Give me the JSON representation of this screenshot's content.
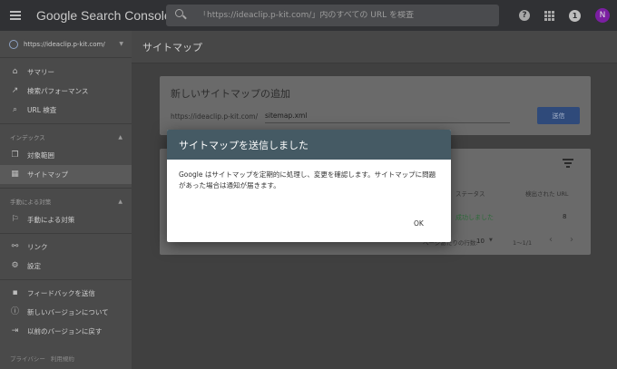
{
  "app": {
    "title": "Google Search Console"
  },
  "search": {
    "placeholder": "「https://ideaclip.p-kit.com/」内のすべての URL を検査"
  },
  "topbar": {
    "help": "?",
    "notifications": "1",
    "avatar": "N"
  },
  "sidebar": {
    "property": "https://ideaclip.p-kit.com/",
    "items": [
      {
        "label": "サマリー",
        "icon": "home-icon"
      },
      {
        "label": "検索パフォーマンス",
        "icon": "trending-icon"
      },
      {
        "label": "URL 検査",
        "icon": "search-icon"
      }
    ],
    "index_section": "インデックス",
    "index_items": [
      {
        "label": "対象範囲",
        "icon": "file-copy-icon"
      },
      {
        "label": "サイトマップ",
        "icon": "sitemap-icon"
      }
    ],
    "manual_section": "手動による対策",
    "manual_items": [
      {
        "label": "手動による対策",
        "icon": "flag-icon"
      }
    ],
    "other_items": [
      {
        "label": "リンク",
        "icon": "links-icon"
      },
      {
        "label": "設定",
        "icon": "settings-icon"
      }
    ],
    "bottom_items": [
      {
        "label": "フィードバックを送信",
        "icon": "feedback-icon"
      },
      {
        "label": "新しいバージョンについて",
        "icon": "info-icon"
      },
      {
        "label": "以前のバージョンに戻す",
        "icon": "exit-icon"
      }
    ],
    "footer": {
      "privacy": "プライバシー",
      "terms": "利用規約"
    }
  },
  "main": {
    "title": "サイトマップ",
    "add_card": {
      "title": "新しいサイトマップの追加",
      "url_prefix": "https://ideaclip.p-kit.com/",
      "input_value": "sitemap.xml",
      "submit": "送信"
    },
    "list_card": {
      "columns": {
        "status": "ステータス",
        "urls": "検出された URL"
      },
      "row": {
        "status": "成功しました",
        "urls": "8"
      },
      "pagination": {
        "rows_label": "ページあたりの行数:",
        "rows": "10",
        "range": "1〜1/1"
      }
    }
  },
  "dialog": {
    "title": "サイトマップを送信しました",
    "body": "Google はサイトマップを定期的に処理し、変更を確認します。サイトマップに問題があった場合は通知が届きます。",
    "ok": "OK"
  }
}
